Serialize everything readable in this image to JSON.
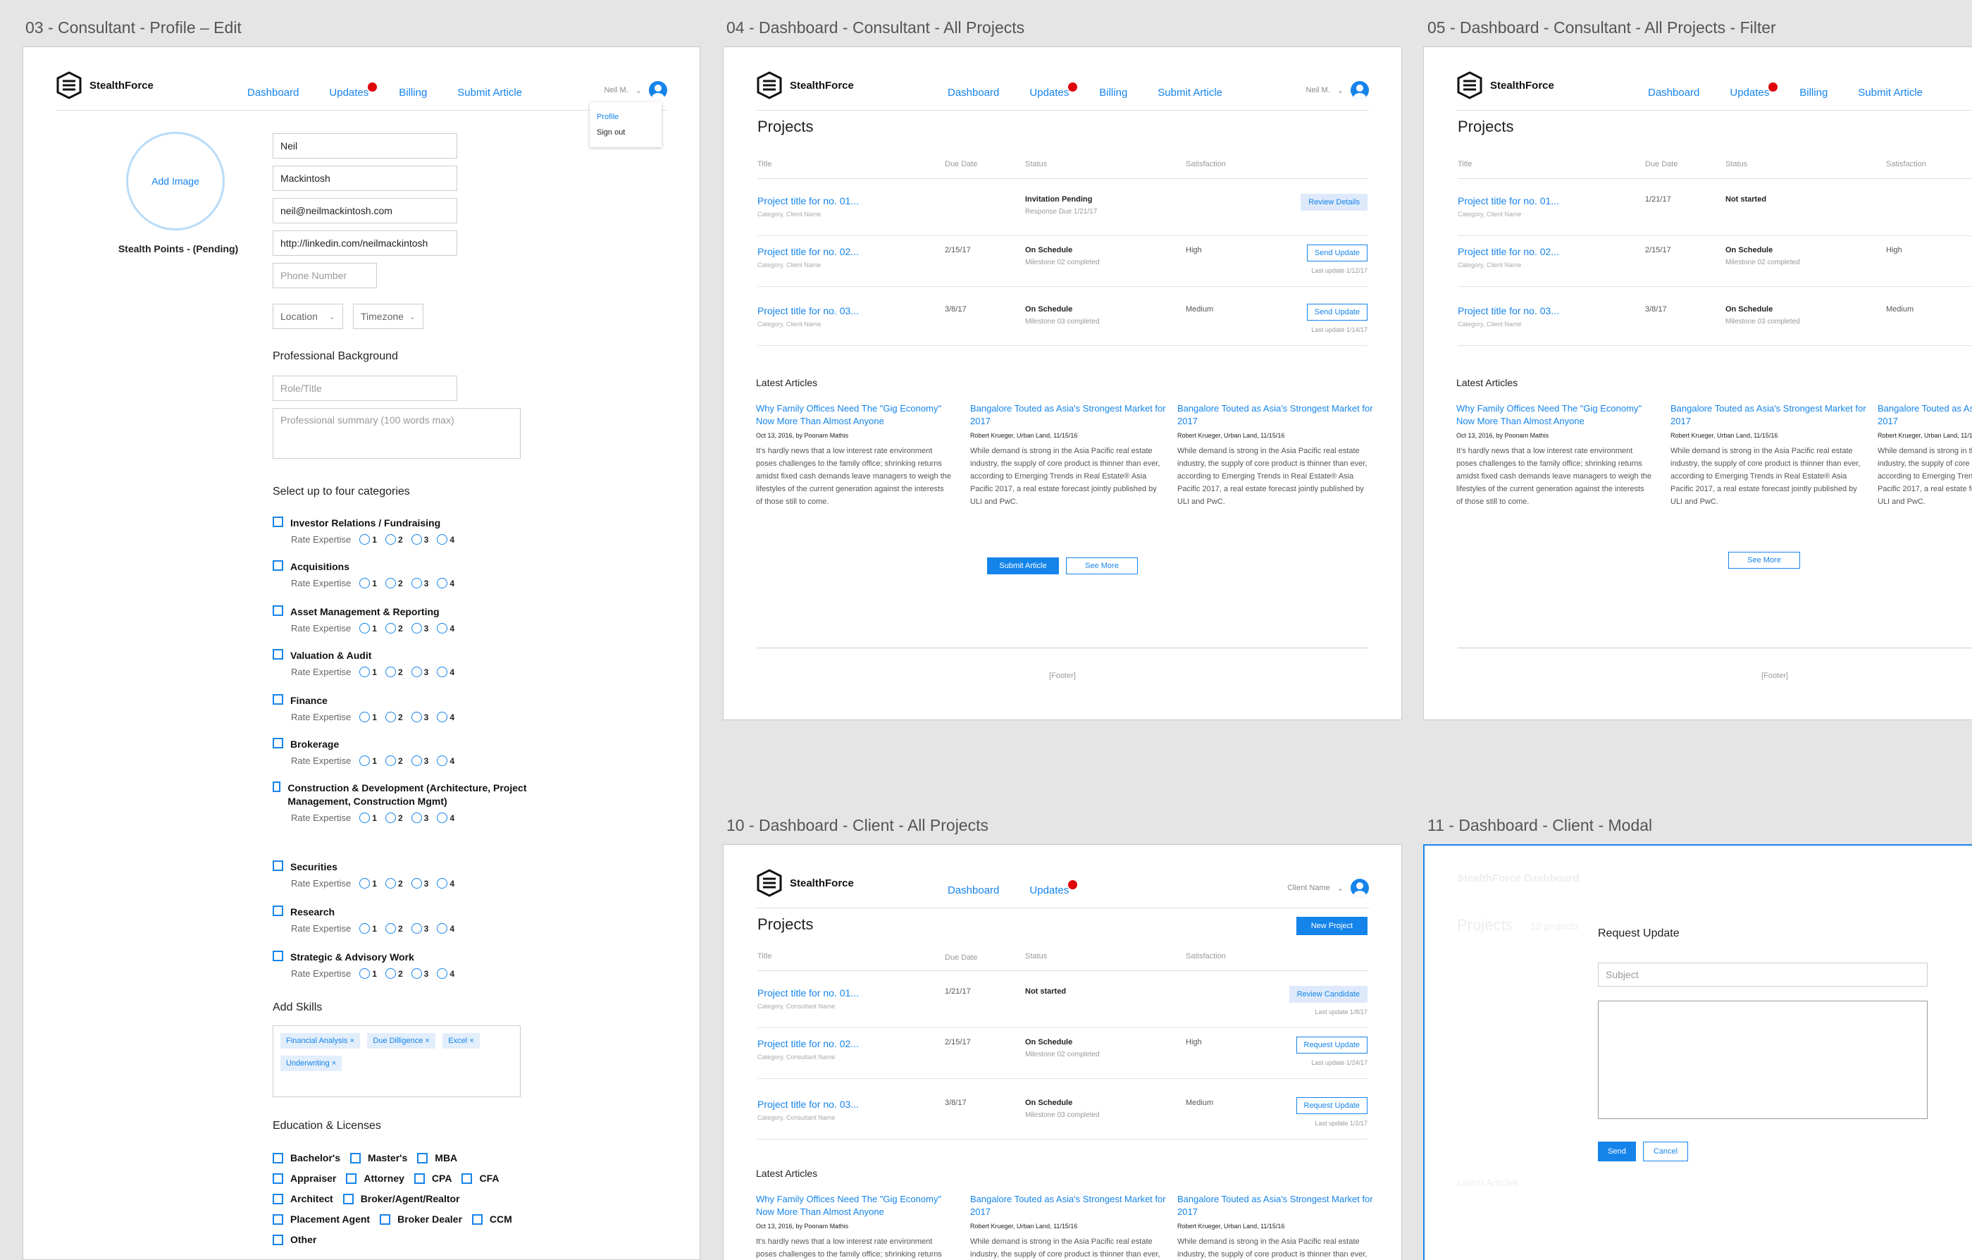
{
  "artboards": {
    "a1": "03 - Consultant - Profile – Edit",
    "a2": "04 - Dashboard - Consultant - All Projects",
    "a3": "05 - Dashboard - Consultant - All Projects - Filter",
    "a4": "10 - Dashboard - Client - All Projects",
    "a5": "11 - Dashboard - Client - Modal"
  },
  "brand": "StealthForce",
  "nav": {
    "dashboard": "Dashboard",
    "updates": "Updates",
    "billing": "Billing",
    "submit": "Submit Article"
  },
  "user": {
    "name": "Neil M.",
    "client_name": "Client Name",
    "menu_profile": "Profile",
    "menu_signout": "Sign out"
  },
  "profile": {
    "add_image": "Add Image",
    "points": "Stealth Points - (Pending)",
    "first": "Neil",
    "last": "Mackintosh",
    "email": "neil@neilmackintosh.com",
    "linkedin": "http://linkedin.com/neilmackintosh",
    "phone_ph": "Phone Number",
    "location": "Location",
    "timezone": "Timezone",
    "bg_heading": "Professional Background",
    "role_ph": "Role/Title",
    "summary_ph": "Professional summary (100 words max)",
    "cat_heading": "Select up to four categories",
    "rate_label": "Rate Expertise",
    "ratings": [
      "1",
      "2",
      "3",
      "4"
    ],
    "categories": [
      "Investor Relations / Fundraising",
      "Acquisitions",
      "Asset Management & Reporting",
      "Valuation & Audit",
      "Finance",
      "Brokerage",
      "Construction & Development (Architecture, Project Management, Construction Mgmt)",
      "Securities",
      "Research",
      "Strategic & Advisory Work"
    ],
    "skills_heading": "Add Skills",
    "skills": [
      "Financial Analysis",
      "Due Dilligence",
      "Excel",
      "Underwriting"
    ],
    "edu_heading": "Education & Licenses",
    "edu": [
      "Bachelor's",
      "Master's",
      "MBA",
      "Appraiser",
      "Attorney",
      "CPA",
      "CFA",
      "Architect",
      "Broker/Agent/Realtor",
      "Placement Agent",
      "Broker Dealer",
      "CCM",
      "Other"
    ]
  },
  "dash": {
    "projects": "Projects",
    "cols": {
      "title": "Title",
      "due": "Due Date",
      "status": "Status",
      "sat": "Satisfaction"
    },
    "p1_title": "Project title for no. 01...",
    "p2_title": "Project title for no. 02...",
    "p3_title": "Project title for no. 03...",
    "cat_client": "Category, Client Name",
    "cat_consultant": "Category, Consultant Name",
    "d2": "2/15/17",
    "d3": "3/8/17",
    "d1c": "1/21/17",
    "inv_pending": "Invitation Pending",
    "resp_due": "Response Due 1/21/17",
    "not_started": "Not started",
    "on_schedule": "On Schedule",
    "ms2": "Milestone 02 completed",
    "ms3": "Milestone 03 completed",
    "high": "High",
    "medium": "Medium",
    "review_details": "Review Details",
    "send_update": "Send Update",
    "lu2": "Last update 1/12/17",
    "lu3": "Last update 1/14/17",
    "review_candidate": "Review Candidate",
    "request_update": "Request Update",
    "lu_c1": "Last update 1/8/17",
    "lu_c2": "Last update 1/24/17",
    "lu_c3": "Last update 1/2/17",
    "new_project": "New Project",
    "latest": "Latest Articles",
    "art1_title": "Why Family Offices Need The \"Gig Economy\" Now More Than Almost Anyone",
    "art1_meta": "Oct 13, 2016, by Poonam Mathis",
    "art1_body": "It's hardly news that a low interest rate environment poses challenges to the family office; shrinking returns amidst fixed cash demands leave managers to weigh the lifestyles of the current generation against the interests of those still to come.",
    "art2_title": "Bangalore Touted as Asia's Strongest Market for 2017",
    "art2_meta": "Robert Krueger, Urban Land, 11/15/16",
    "art2_body": "While demand is strong in the Asia Pacific real estate industry, the supply of core product is thinner than ever, according to Emerging Trends in Real Estate® Asia Pacific 2017, a real estate forecast jointly published by ULI and PwC.",
    "submit_article": "Submit Article",
    "see_more": "See More",
    "footer": "[Footer]"
  },
  "modal": {
    "title": "Request Update",
    "subject_ph": "Subject",
    "send": "Send",
    "cancel": "Cancel",
    "bg_brand": "StealthForce Dashboard",
    "bg_projects": "Projects",
    "bg_count": "12 projects",
    "bg_latest": "Latest Articles"
  }
}
